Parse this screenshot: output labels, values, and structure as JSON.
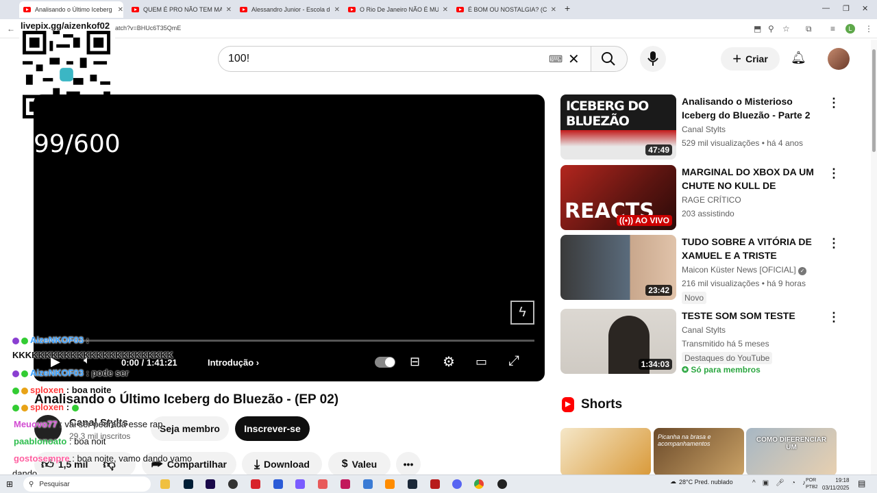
{
  "browser": {
    "tabs": [
      {
        "title": "Analisando o Último Iceberg do",
        "active": true
      },
      {
        "title": "QUEM É PRO NÃO TEM MAIN |",
        "active": false
      },
      {
        "title": "Alessandro Junior - Escola de A",
        "active": false
      },
      {
        "title": "O Rio De Janeiro NÃO É MUITO",
        "active": false
      },
      {
        "title": "É BOM OU NOSTALGIA? (COM",
        "active": false
      }
    ],
    "url": "atch?v=BHUc6T35QmE",
    "profile_initial": "L"
  },
  "overlay": {
    "qr_label": "livepix.gg/aizenkof02",
    "counter": "99/600"
  },
  "header": {
    "search_value": "100!",
    "create_label": "Criar"
  },
  "player": {
    "time": "0:00 / 1:41:21",
    "chapter": "Introdução",
    "progress": 0.0
  },
  "video": {
    "title": "Analisando o Último Iceberg do Bluezão - (EP 02)",
    "channel": "Canal Stylts",
    "subscribers": "29,3 mil inscritos",
    "member_label": "Seja membro",
    "subscribe_label": "Inscrever-se",
    "likes": "1,5 mil",
    "share_label": "Compartilhar",
    "download_label": "Download",
    "thanks_label": "Valeu"
  },
  "chat": [
    {
      "user": "AizeNKOF03",
      "text": ":",
      "color": "#3aa0ff"
    },
    {
      "user": "",
      "text": "KKKKKKKKKKKKKKKKKKKKKKKKK",
      "color": "#ffffff"
    },
    {
      "user": "AizeNKOF03",
      "text": ": pode ser",
      "color": "#3aa0ff"
    },
    {
      "user": "sploxen",
      "text": ": boa noite",
      "color": "#ff3b3b"
    },
    {
      "user": "sploxen",
      "text": ":",
      "color": "#ff3b3b"
    },
    {
      "user": "Meuovo77",
      "text": ": vai ser pedrada esse rap",
      "color": "#d24bd2"
    },
    {
      "user": "paablonoato",
      "text": ": boa noit",
      "color": "#2ebd4e"
    },
    {
      "user": "gostosempre",
      "text": ": boa noite, vamo dando vamo",
      "color": "#ff5fa0"
    },
    {
      "user": "",
      "text": "dando",
      "color": "#ffffff"
    }
  ],
  "related": [
    {
      "title": "Analisando o Misterioso Iceberg do Bluezão - Parte 2",
      "channel": "Canal Stylts",
      "meta": "529 mil visualizações • há 4 anos",
      "duration": "47:49",
      "thumb_text": "ICEBERG DO BLUEZÃO"
    },
    {
      "title": "MARGINAL DO XBOX DA UM CHUTE NO KULL DE MADEIRA…",
      "channel": "RAGE CRÍTICO",
      "meta": "203 assistindo",
      "duration": "AO VIVO",
      "thumb_text": "REACTS"
    },
    {
      "title": "TUDO SOBRE A VITÓRIA DE XAMUEL E A TRISTE DERROT…",
      "channel": "Maicon Küster News [OFICIAL]",
      "meta": "216 mil visualizações • há 9 horas",
      "duration": "23:42",
      "tag": "Novo"
    },
    {
      "title": "TESTE SOM SOM TESTE",
      "channel": "Canal Stylts",
      "meta": "Transmitido há 5 meses",
      "duration": "1:34:03",
      "tag": "Destaques do YouTube",
      "members": "Só para membros"
    }
  ],
  "shorts": {
    "label": "Shorts",
    "items": [
      {
        "text": ""
      },
      {
        "text": "Picanha na brasa e acompanhamentos"
      },
      {
        "text": "COMO DIFERENCIAR UM"
      }
    ]
  },
  "taskbar": {
    "search_placeholder": "Pesquisar",
    "weather": "28°C Pred. nublado",
    "lang": "POR PTB2",
    "time": "19:18",
    "date": "03/11/2025"
  }
}
